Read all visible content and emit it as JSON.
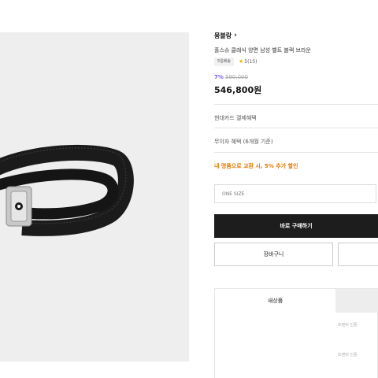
{
  "product": {
    "brand": "몽블랑",
    "name": "홀스슈 클래식 양면 남성 벨트 블랙 브라운",
    "delivery_badge": "5일배송",
    "rating": "5(15)",
    "discount": "7%",
    "original_price": "590,000",
    "price": "546,800원"
  },
  "benefits": {
    "card": "현대카드 결제혜택",
    "installment": "무이자 혜택 (6개월 기준)",
    "exchange": "내 명품으로 교환 시, 5% 추가 할인"
  },
  "option": {
    "value": "ONE SIZE"
  },
  "actions": {
    "buy": "바로 구매하기",
    "cart": "장바구니"
  },
  "tabs": {
    "new": "새상품"
  },
  "seller_lines": [
    "트렌비 인증",
    "트렌비 인증"
  ],
  "colors": {
    "discount": "#7b5cf5",
    "exchange": "#e07a00",
    "buy_bg": "#1d1d1d",
    "star": "#f5b400"
  },
  "icons": {
    "brand_link": "chevron-right-icon",
    "rating": "star-icon"
  }
}
